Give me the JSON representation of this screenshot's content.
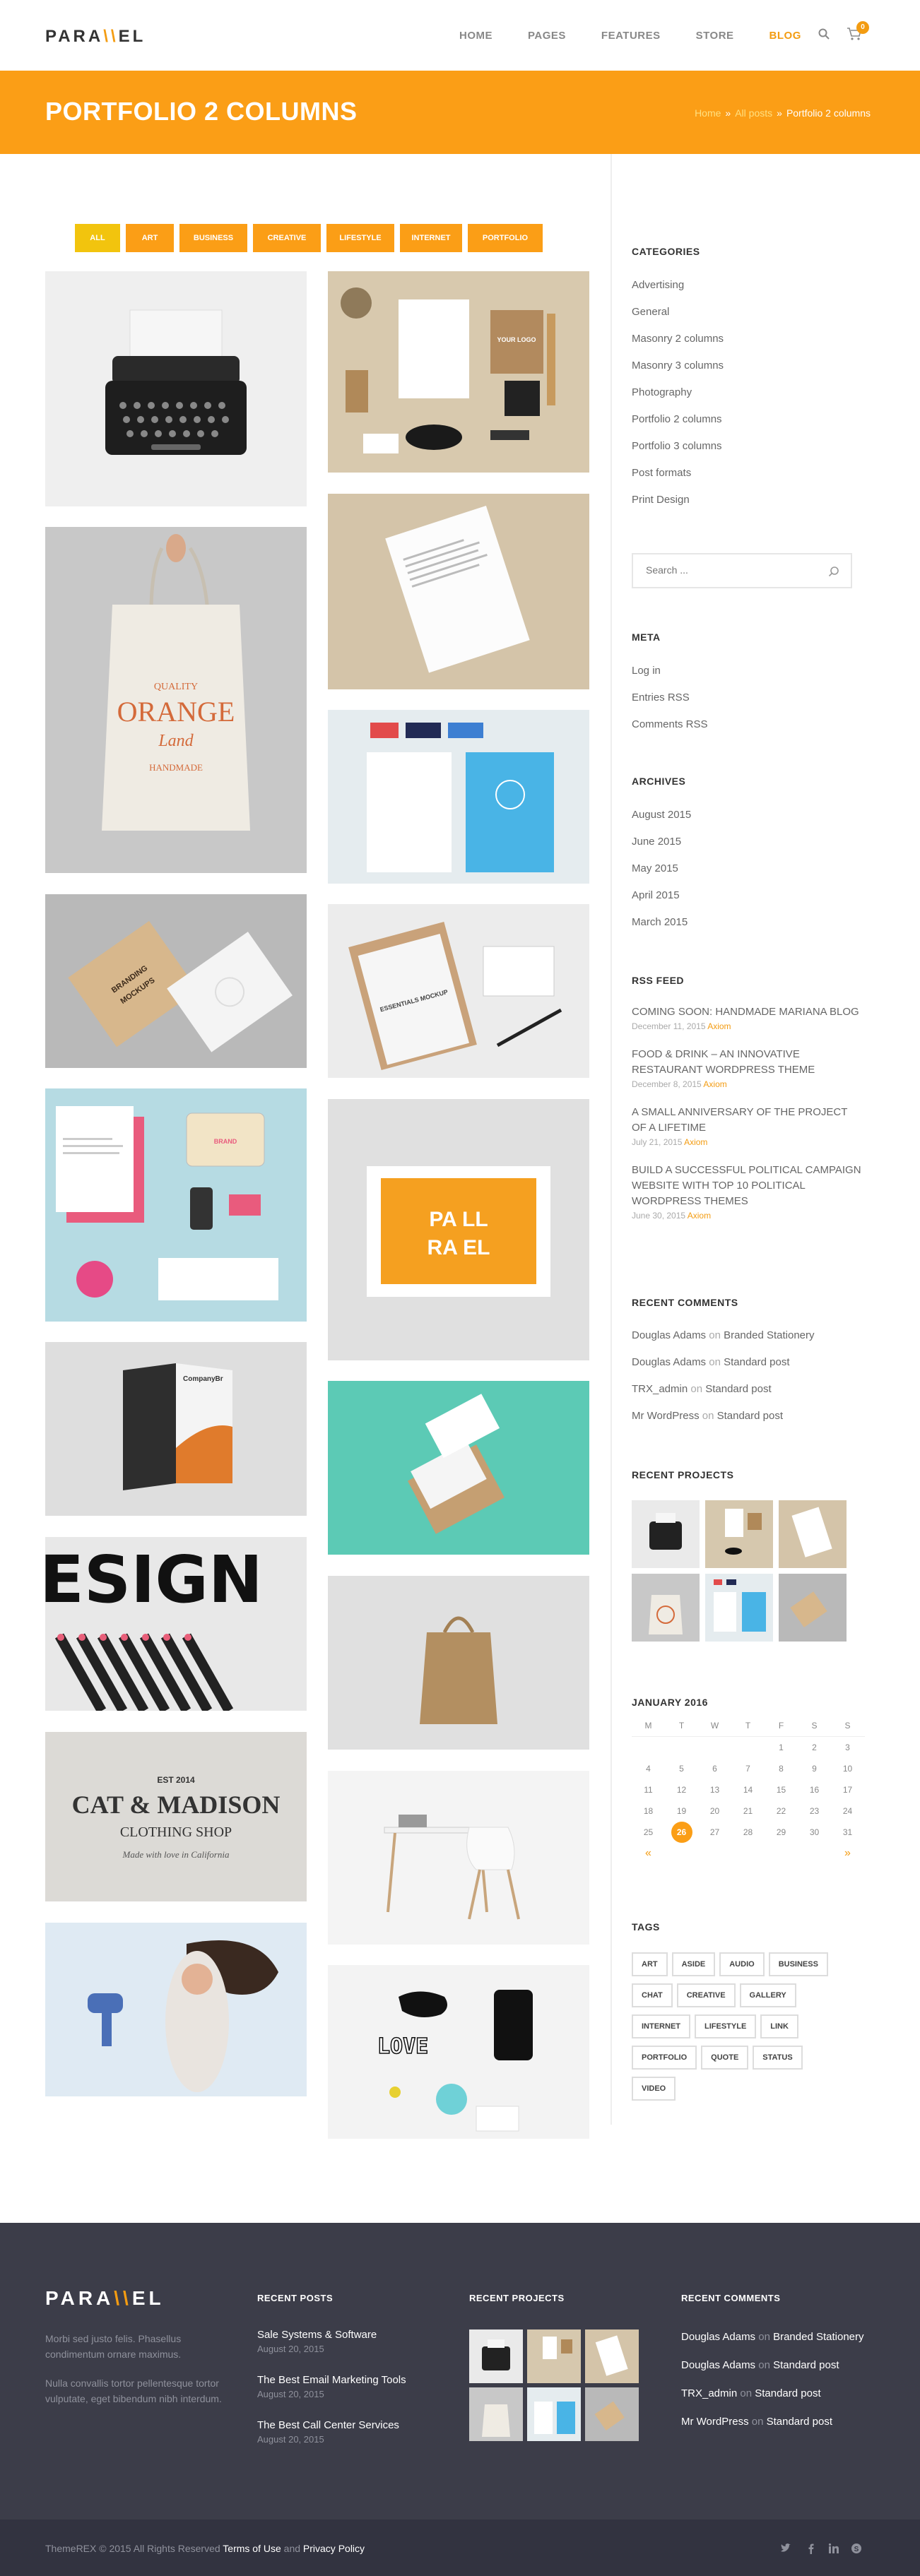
{
  "header": {
    "logo": {
      "left": "PARA",
      "slash": "\\\\",
      "right": "EL"
    },
    "nav": [
      "HOME",
      "PAGES",
      "FEATURES",
      "STORE",
      "BLOG"
    ],
    "active_nav": "BLOG",
    "cart_count": "0"
  },
  "title_band": {
    "title": "PORTFOLIO 2 COLUMNS",
    "breadcrumb": [
      "Home",
      "All posts",
      "Portfolio 2 columns"
    ]
  },
  "filters": [
    "ALL",
    "ART",
    "BUSINESS",
    "CREATIVE",
    "LIFESTYLE",
    "INTERNET",
    "PORTFOLIO"
  ],
  "active_filter": "ALL",
  "portfolio_items": {
    "frame_text_1": "PA LL",
    "frame_text_2": "RA EL",
    "tote_text_1": "QUALITY",
    "tote_text_2": "ORANGE",
    "tote_text_3": "Land",
    "tote_text_4": "HANDMADE",
    "brand_text": "BRANDING",
    "mockups_text": "MOCKUPS",
    "design_text": "ESIGN",
    "cat_text_1": "CAT & MADISON",
    "cat_text_2": "CLOTHING SHOP",
    "cat_text_3": "Made with love in California",
    "cat_est": "EST 2014",
    "love_text": "LOVE",
    "essentials_text": "ESSENTIALS MOCKUP",
    "company_text": "CompanyBr",
    "your_logo": "YOUR LOGO",
    "orange_brand": "BRAND"
  },
  "sidebar": {
    "categories_title": "CATEGORIES",
    "categories": [
      "Advertising",
      "General",
      "Masonry 2 columns",
      "Masonry 3 columns",
      "Photography",
      "Portfolio 2 columns",
      "Portfolio 3 columns",
      "Post formats",
      "Print Design"
    ],
    "search_placeholder": "Search ...",
    "meta_title": "META",
    "meta": [
      "Log in",
      "Entries RSS",
      "Comments RSS"
    ],
    "archives_title": "ARCHIVES",
    "archives": [
      "August 2015",
      "June 2015",
      "May 2015",
      "April 2015",
      "March 2015"
    ],
    "rss_title": "RSS FEED",
    "rss": [
      {
        "title": "COMING SOON: HANDMADE MARIANA BLOG",
        "date": "December 11, 2015",
        "author": "Axiom"
      },
      {
        "title": "FOOD & DRINK – AN INNOVATIVE RESTAURANT WORDPRESS THEME",
        "date": "December 8, 2015",
        "author": "Axiom"
      },
      {
        "title": "A SMALL ANNIVERSARY OF THE PROJECT OF A LIFETIME",
        "date": "July 21, 2015",
        "author": "Axiom"
      },
      {
        "title": "BUILD A SUCCESSFUL POLITICAL CAMPAIGN WEBSITE WITH TOP 10 POLITICAL WORDPRESS THEMES",
        "date": "June 30, 2015",
        "author": "Axiom"
      }
    ],
    "comments_title": "RECENT COMMENTS",
    "comments": [
      {
        "author": "Douglas Adams",
        "on": "on",
        "post": "Branded Stationery"
      },
      {
        "author": "Douglas Adams",
        "on": "on",
        "post": "Standard post"
      },
      {
        "author": "TRX_admin",
        "on": "on",
        "post": "Standard post"
      },
      {
        "author": "Mr WordPress",
        "on": "on",
        "post": "Standard post"
      }
    ],
    "projects_title": "RECENT PROJECTS",
    "calendar": {
      "title": "JANUARY 2016",
      "days": [
        "M",
        "T",
        "W",
        "T",
        "F",
        "S",
        "S"
      ],
      "weeks": [
        [
          "",
          "",
          "",
          "",
          "1",
          "2",
          "3"
        ],
        [
          "4",
          "5",
          "6",
          "7",
          "8",
          "9",
          "10"
        ],
        [
          "11",
          "12",
          "13",
          "14",
          "15",
          "16",
          "17"
        ],
        [
          "18",
          "19",
          "20",
          "21",
          "22",
          "23",
          "24"
        ],
        [
          "25",
          "26",
          "27",
          "28",
          "29",
          "30",
          "31"
        ]
      ],
      "today": "26",
      "prev": "«",
      "next": "»"
    },
    "tags_title": "TAGS",
    "tags": [
      "ART",
      "ASIDE",
      "AUDIO",
      "BUSINESS",
      "CHAT",
      "CREATIVE",
      "GALLERY",
      "INTERNET",
      "LIFESTYLE",
      "LINK",
      "PORTFOLIO",
      "QUOTE",
      "STATUS",
      "VIDEO"
    ]
  },
  "footer": {
    "logo": {
      "left": "PARA",
      "slash": "\\\\",
      "right": "EL"
    },
    "about_1": "Morbi sed justo felis. Phasellus condimentum ornare maximus.",
    "about_2": "Nulla convallis tortor pellentesque tortor vulputate, eget bibendum nibh interdum.",
    "posts_title": "RECENT POSTS",
    "posts": [
      {
        "title": "Sale Systems & Software",
        "date": "August 20, 2015"
      },
      {
        "title": "The Best Email Marketing Tools",
        "date": "August 20, 2015"
      },
      {
        "title": "The Best Call Center Services",
        "date": "August 20, 2015"
      }
    ],
    "projects_title": "RECENT PROJECTS",
    "comments_title": "RECENT COMMENTS",
    "comments": [
      {
        "author": "Douglas Adams",
        "on": "on",
        "post": "Branded Stationery"
      },
      {
        "author": "Douglas Adams",
        "on": "on",
        "post": "Standard post"
      },
      {
        "author": "TRX_admin",
        "on": "on",
        "post": "Standard post"
      },
      {
        "author": "Mr WordPress",
        "on": "on",
        "post": "Standard post"
      }
    ]
  },
  "bottom_bar": {
    "copyright_prefix": "ThemeREX © 2015 All Rights Reserved",
    "terms": "Terms of Use",
    "and": "and",
    "privacy": "Privacy Policy",
    "social": [
      "twitter",
      "facebook",
      "linkedin",
      "skype"
    ]
  },
  "colors": {
    "accent": "#fb9e16",
    "active_filter": "#f2c40e",
    "footer_bg": "#3c3d49",
    "bottom_bg": "#323340"
  }
}
